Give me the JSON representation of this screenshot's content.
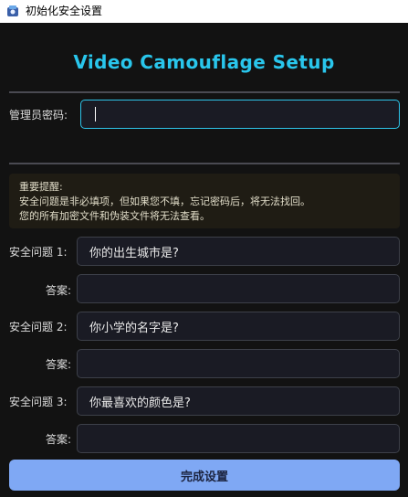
{
  "window": {
    "title": "初始化安全设置",
    "icon": "video-camouflage-app-icon"
  },
  "heading": "Video Camouflage Setup",
  "admin": {
    "label": "管理员密码:",
    "value": ""
  },
  "notice": {
    "title": "重要提醒:",
    "line1": "安全问题是非必填项，但如果您不填，忘记密码后，将无法找回。",
    "line2": "您的所有加密文件和伪装文件将无法查看。"
  },
  "questions": [
    {
      "label": "安全问题 1:",
      "value": "你的出生城市是?",
      "answer_label": "答案:",
      "answer": ""
    },
    {
      "label": "安全问题 2:",
      "value": "你小学的名字是?",
      "answer_label": "答案:",
      "answer": ""
    },
    {
      "label": "安全问题 3:",
      "value": "你最喜欢的颜色是?",
      "answer_label": "答案:",
      "answer": ""
    }
  ],
  "submit_label": "完成设置",
  "colors": {
    "accent": "#29c6ec",
    "button": "#7fa8f4",
    "background": "#121212"
  }
}
